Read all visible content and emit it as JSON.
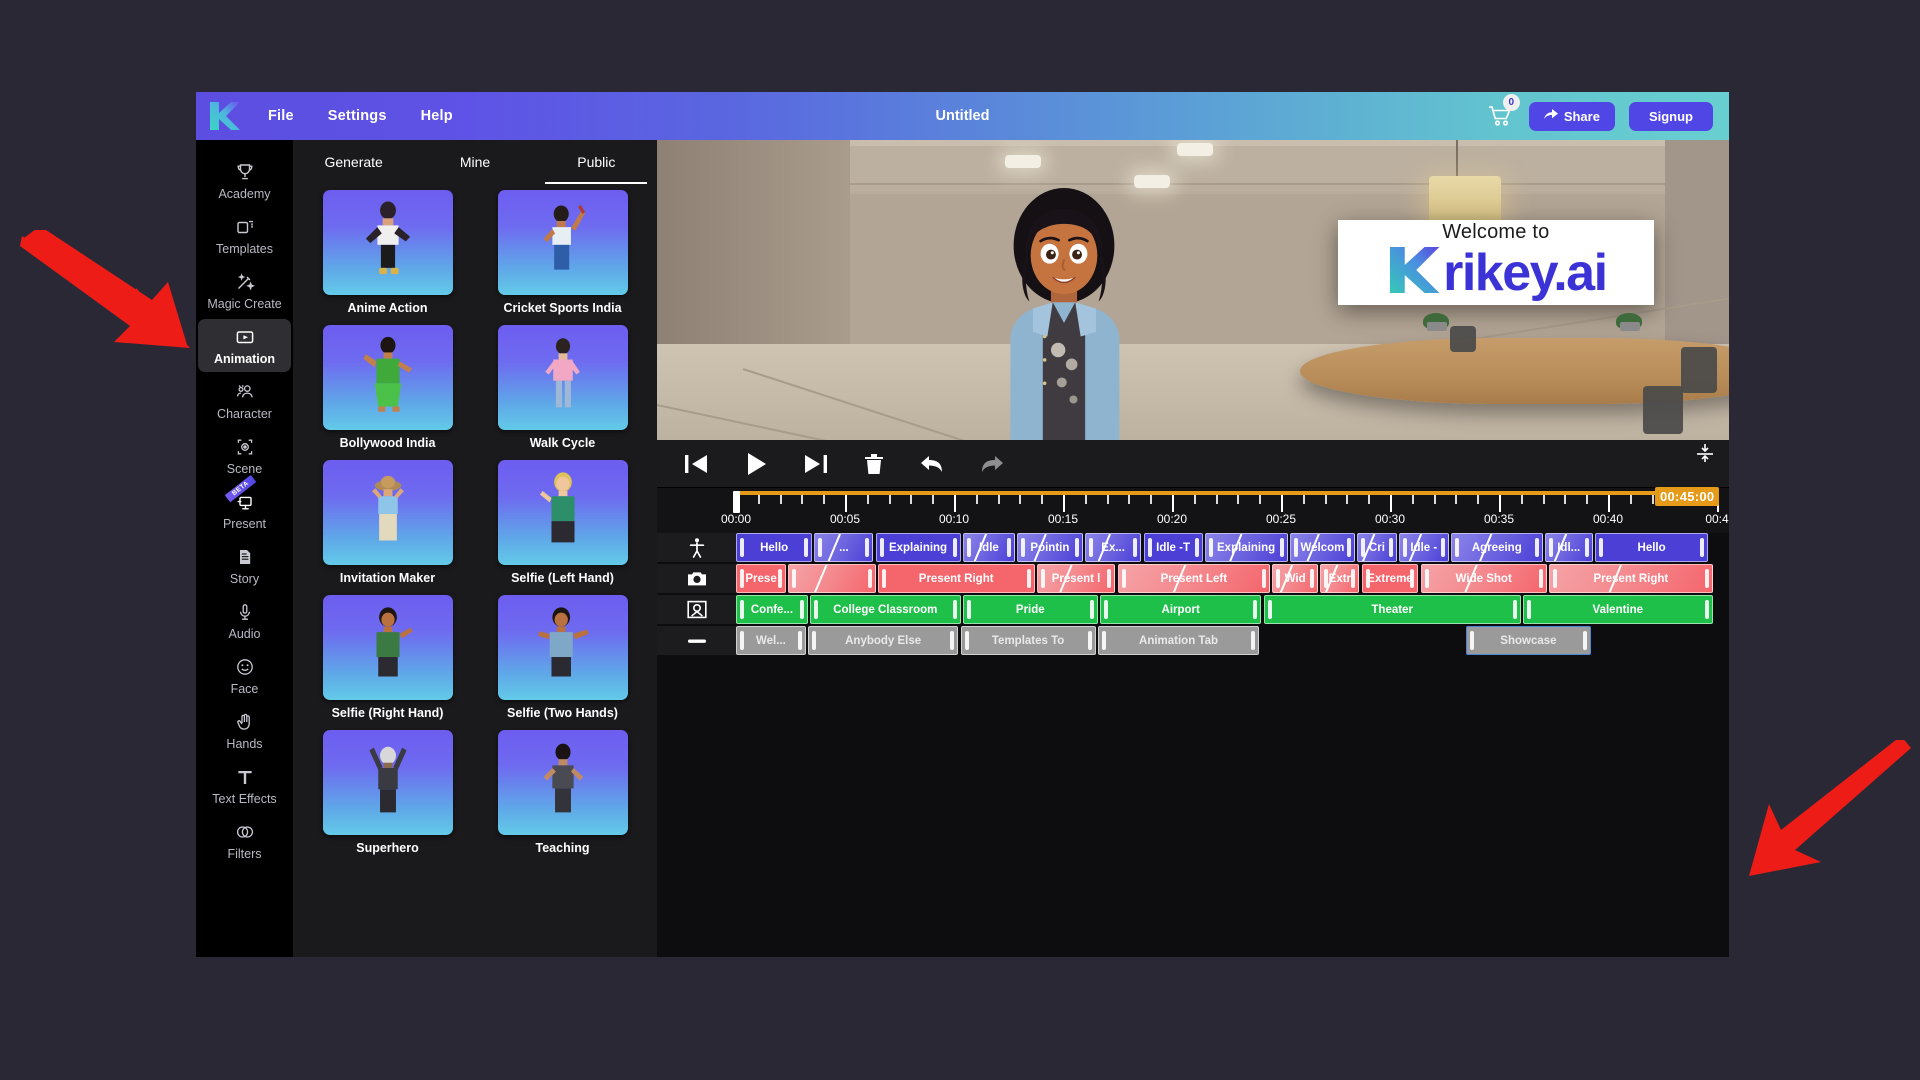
{
  "topbar": {
    "menus": [
      "File",
      "Settings",
      "Help"
    ],
    "title": "Untitled",
    "cart_badge": "0",
    "share_label": "Share",
    "signup_label": "Signup",
    "brand_logo": "krikey-k-logo"
  },
  "sidebar": {
    "items": [
      {
        "label": "Academy",
        "icon": "trophy-icon",
        "active": false,
        "badge": ""
      },
      {
        "label": "Templates",
        "icon": "templates-icon",
        "active": false,
        "badge": ""
      },
      {
        "label": "Magic Create",
        "icon": "magic-wand-icon",
        "active": false,
        "badge": ""
      },
      {
        "label": "Animation",
        "icon": "animation-icon",
        "active": true,
        "badge": ""
      },
      {
        "label": "Character",
        "icon": "character-icon",
        "active": false,
        "badge": ""
      },
      {
        "label": "Scene",
        "icon": "scene-icon",
        "active": false,
        "badge": ""
      },
      {
        "label": "Present",
        "icon": "present-icon",
        "active": false,
        "badge": "BETA"
      },
      {
        "label": "Story",
        "icon": "story-icon",
        "active": false,
        "badge": ""
      },
      {
        "label": "Audio",
        "icon": "microphone-icon",
        "active": false,
        "badge": ""
      },
      {
        "label": "Face",
        "icon": "smiley-face-icon",
        "active": false,
        "badge": ""
      },
      {
        "label": "Hands",
        "icon": "hand-icon",
        "active": false,
        "badge": ""
      },
      {
        "label": "Text Effects",
        "icon": "text-effects-icon",
        "active": false,
        "badge": ""
      },
      {
        "label": "Filters",
        "icon": "filters-icon",
        "active": false,
        "badge": ""
      }
    ]
  },
  "panel": {
    "tabs": [
      {
        "label": "Generate",
        "active": false
      },
      {
        "label": "Mine",
        "active": false
      },
      {
        "label": "Public",
        "active": true
      }
    ],
    "cards": [
      {
        "label": "Anime Action"
      },
      {
        "label": "Cricket Sports India"
      },
      {
        "label": "Bollywood India"
      },
      {
        "label": "Walk Cycle"
      },
      {
        "label": "Invitation Maker"
      },
      {
        "label": "Selfie (Left Hand)"
      },
      {
        "label": "Selfie (Right Hand)"
      },
      {
        "label": "Selfie (Two Hands)"
      },
      {
        "label": "Superhero"
      },
      {
        "label": "Teaching"
      }
    ]
  },
  "viewport": {
    "screen_line1": "Welcome to",
    "screen_brand": "rikey.ai",
    "screen_logo": "krikey-k-logo"
  },
  "transport": {
    "buttons": [
      {
        "name": "skip-to-start-button",
        "icon": "skip-start-icon"
      },
      {
        "name": "play-button",
        "icon": "play-icon"
      },
      {
        "name": "skip-to-end-button",
        "icon": "skip-end-icon"
      },
      {
        "name": "delete-button",
        "icon": "trash-icon"
      },
      {
        "name": "undo-button",
        "icon": "undo-arrow-icon"
      },
      {
        "name": "redo-button",
        "icon": "redo-arrow-icon"
      }
    ],
    "fit_icon": "fit-to-screen-icon"
  },
  "timeline": {
    "current_time": "00:45:00",
    "tick_labels": [
      "00:00",
      "00:05",
      "00:10",
      "00:15",
      "00:20",
      "00:25",
      "00:30",
      "00:35",
      "00:40",
      "00:4"
    ],
    "total_seconds": 45,
    "tracks": [
      {
        "name": "animation-track",
        "icon": "body-person-icon",
        "type": "anim",
        "clips": [
          {
            "label": "Hello",
            "start": 0.0,
            "end": 3.5,
            "fade": false
          },
          {
            "label": "...",
            "start": 3.6,
            "end": 6.3,
            "fade": true
          },
          {
            "label": "Explaining",
            "start": 6.4,
            "end": 10.3,
            "fade": false
          },
          {
            "label": "Idle",
            "start": 10.4,
            "end": 12.8,
            "fade": true
          },
          {
            "label": "Pointin",
            "start": 12.9,
            "end": 15.9,
            "fade": true
          },
          {
            "label": "Ex...",
            "start": 16.0,
            "end": 18.6,
            "fade": true
          },
          {
            "label": "Idle -T",
            "start": 18.7,
            "end": 21.4,
            "fade": false
          },
          {
            "label": "Explaining",
            "start": 21.5,
            "end": 25.3,
            "fade": true
          },
          {
            "label": "Welcom",
            "start": 25.4,
            "end": 28.4,
            "fade": true
          },
          {
            "label": "Cri",
            "start": 28.5,
            "end": 30.3,
            "fade": true
          },
          {
            "label": "Idle -",
            "start": 30.4,
            "end": 32.7,
            "fade": true
          },
          {
            "label": "Agreeing",
            "start": 32.8,
            "end": 37.0,
            "fade": true
          },
          {
            "label": "Idl...",
            "start": 37.1,
            "end": 39.3,
            "fade": true
          },
          {
            "label": "Hello",
            "start": 39.4,
            "end": 44.6,
            "fade": false
          }
        ]
      },
      {
        "name": "camera-track",
        "icon": "camera-icon",
        "type": "cam",
        "clips": [
          {
            "label": "Prese",
            "start": 0.0,
            "end": 2.3,
            "fade": false
          },
          {
            "label": "",
            "start": 2.4,
            "end": 6.4,
            "fade": true
          },
          {
            "label": "Present Right",
            "start": 6.5,
            "end": 13.7,
            "fade": false
          },
          {
            "label": "Present l",
            "start": 13.8,
            "end": 17.4,
            "fade": true
          },
          {
            "label": "Present Left",
            "start": 17.5,
            "end": 24.5,
            "fade": true
          },
          {
            "label": "Wid",
            "start": 24.6,
            "end": 26.7,
            "fade": true
          },
          {
            "label": "Extr",
            "start": 26.8,
            "end": 28.6,
            "fade": true
          },
          {
            "label": "Extreme",
            "start": 28.7,
            "end": 31.3,
            "fade": false
          },
          {
            "label": "Wide Shot",
            "start": 31.4,
            "end": 37.2,
            "fade": true
          },
          {
            "label": "Present Right",
            "start": 37.3,
            "end": 44.8,
            "fade": true
          }
        ]
      },
      {
        "name": "scene-track",
        "icon": "scene-frame-icon",
        "type": "scene",
        "clips": [
          {
            "label": "Confe...",
            "start": 0.0,
            "end": 3.3,
            "fade": false
          },
          {
            "label": "College Classroom",
            "start": 3.4,
            "end": 10.3,
            "fade": false
          },
          {
            "label": "Pride",
            "start": 10.4,
            "end": 16.6,
            "fade": false
          },
          {
            "label": "Airport",
            "start": 16.7,
            "end": 24.1,
            "fade": false
          },
          {
            "label": "Theater",
            "start": 24.2,
            "end": 36.0,
            "fade": false
          },
          {
            "label": "Valentine",
            "start": 36.1,
            "end": 44.8,
            "fade": false
          }
        ]
      },
      {
        "name": "audio-track",
        "icon": "audio-waveform-icon",
        "type": "grey",
        "clips": [
          {
            "label": "Wel...",
            "start": 0.0,
            "end": 3.2,
            "selected": false
          },
          {
            "label": "Anybody Else",
            "start": 3.3,
            "end": 10.2,
            "selected": false
          },
          {
            "label": "Templates To",
            "start": 10.3,
            "end": 16.5,
            "selected": false
          },
          {
            "label": "Animation Tab",
            "start": 16.6,
            "end": 24.0,
            "selected": false
          },
          {
            "label": "Showcase",
            "start": 33.5,
            "end": 39.2,
            "selected": true
          }
        ]
      }
    ]
  },
  "annotations": {
    "arrow_color": "#ee1c17",
    "arrows": [
      "pointer-arrow-top-left",
      "pointer-arrow-bottom-right"
    ]
  }
}
